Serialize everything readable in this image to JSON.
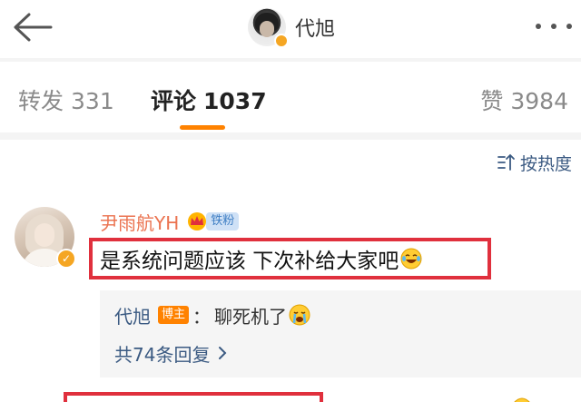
{
  "header": {
    "name": "代旭",
    "back_icon": "back-arrow-icon",
    "more_icon": "more-dots-icon"
  },
  "tabs": [
    {
      "label": "转发",
      "count": "331"
    },
    {
      "label": "评论",
      "count": "1037"
    },
    {
      "label": "赞",
      "count": "3984"
    }
  ],
  "sort": {
    "label": "按热度",
    "icon": "sort-icon"
  },
  "comment": {
    "user": "尹雨航YH",
    "fan_badge": "铁粉",
    "vip_badge": "crown-icon",
    "text": "是系统问题应该 下次补给大家吧",
    "emoji": "laugh-cry-emoji-icon",
    "reply": {
      "user": "代旭",
      "badge": "博主",
      "colon": "：",
      "text": "聊死机了",
      "emoji": "crying-emoji-icon"
    },
    "reply_count_label": "共74条回复"
  },
  "colors": {
    "accent": "#ff8200",
    "link": "#3b5a82",
    "username": "#eb7350",
    "highlight": "#e0303d"
  }
}
